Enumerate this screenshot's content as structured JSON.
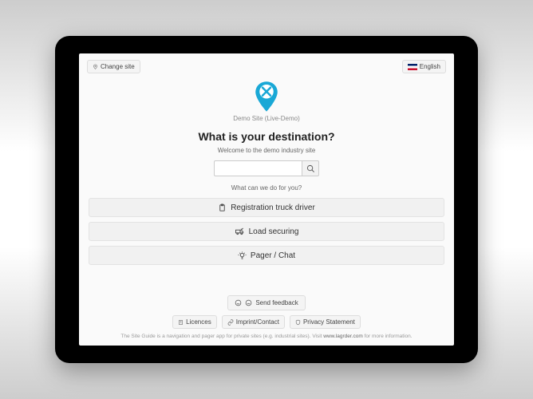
{
  "topbar": {
    "change_site": "Change site",
    "language": "English"
  },
  "site": {
    "name": "Demo Site (Live-Demo)"
  },
  "hero": {
    "headline": "What is your destination?",
    "subline": "Welcome to the demo industry site",
    "help": "What can we do for you?"
  },
  "search": {
    "placeholder": ""
  },
  "actions": {
    "register": "Registration truck driver",
    "securing": "Load securing",
    "pager": "Pager / Chat"
  },
  "footer": {
    "feedback": "Send feedback",
    "licences": "Licences",
    "imprint": "Imprint/Contact",
    "privacy": "Privacy Statement",
    "note_pre": "The Site Guide is a navigation and pager app for private sites (e.g. industrial sites). Visit ",
    "note_link": "www.lagrder.com",
    "note_post": " for more information."
  }
}
